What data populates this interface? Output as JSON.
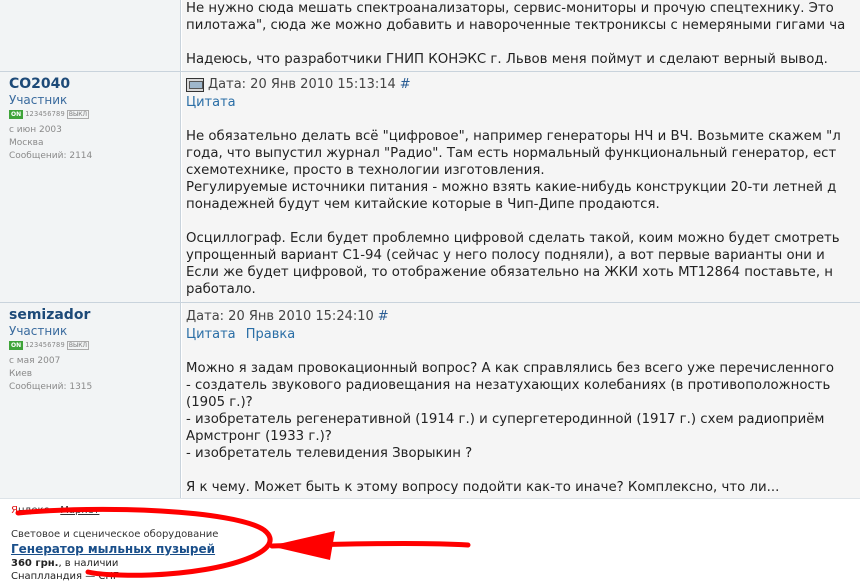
{
  "top_post": {
    "lines": [
      "Не нужно сюда мешать спектроанализаторы, сервис-мониторы и прочую спецтехнику. Это",
      "пилотажа\", сюда же можно добавить и навороченные тектрониксы с немеряными гигами ча",
      "",
      "Надеюсь, что разработчики ГНИП КОНЭКС г. Львов меня поймут и сделают верный вывод."
    ]
  },
  "posts": [
    {
      "author": "CO2040",
      "role": "Участник",
      "rating_on": "ON",
      "rating_nums": "123456789",
      "rating_box": "ВЫКЛ",
      "since": "с июн 2003",
      "city": "Москва",
      "messages": "Сообщений: 2114",
      "date": "Дата: 20 Янв 2010 15:13:14",
      "hash": "#",
      "quote_links": [
        "Цитата"
      ],
      "lines": [
        "",
        "Не обязательно делать всё \"цифровое\", например генераторы НЧ и ВЧ. Возьмите скажем \"л",
        "года, что выпустил журнал \"Радио\". Там есть нормальный функциональный генератор, ест",
        "схемотехнике, просто в технологии изготовления.",
        "Регулируемые источники питания - можно взять какие-нибудь конструкции 20-ти летней д",
        "понадежней будут чем китайские которые в Чип-Дипе продаются.",
        "",
        "Осциллограф. Если будет проблемно цифровой сделать такой, коим можно будет смотреть",
        "упрощенный вариант С1-94 (сейчас у него полосу подняли), а вот первые варианты они и",
        "Если же будет цифровой, то отображение обязательно на ЖКИ хоть МТ12864 поставьте, н",
        "работало."
      ]
    },
    {
      "author": "semizador",
      "role": "Участник",
      "rating_on": "ON",
      "rating_nums": "123456789",
      "rating_box": "ВЫКЛ",
      "since": "с мая 2007",
      "city": "Киев",
      "messages": "Сообщений: 1315",
      "date": "Дата: 20 Янв 2010 15:24:10",
      "hash": "#",
      "quote_links": [
        "Цитата",
        "Правка"
      ],
      "lines": [
        "",
        "Можно я задам провокационный вопрос? А как справлялись без всего уже перечисленного",
        "- создатель звукового радиовещания на незатухающих колебаниях (в противоположность",
        "(1905 г.)?",
        "- изобретатель регенеративной (1914 г.) и супергетеродинной (1917 г.) схем радиоприём",
        "Армстронг (1933 г.)?",
        "- изобретатель телевидения Зворыкин ?",
        "",
        "Я к чему. Может быть к этому вопросу подойти как-то иначе? Комплексно, что ли..."
      ]
    }
  ],
  "ad": {
    "yandex_first": "Я",
    "yandex_rest": "ндекс",
    "market": "Маркет",
    "category": "Световое и сценическое оборудование",
    "title": "Генератор мыльных пузырей",
    "price": "360 грн.",
    "availability": ", в наличии",
    "shop": "Снаплландия — СНГ"
  },
  "colors": {
    "annotation_arrow": "#ff0000",
    "author_link": "#1d4a78",
    "quote_link": "#2a6ea6"
  }
}
